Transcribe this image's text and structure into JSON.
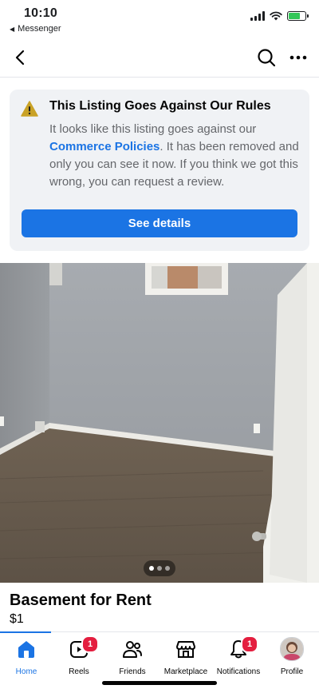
{
  "status_bar": {
    "time": "10:10",
    "back_app": "Messenger"
  },
  "nav": {
    "back_icon": "chevron-left-icon",
    "search_icon": "search-icon",
    "more_icon": "more-icon"
  },
  "notice": {
    "title": "This Listing Goes Against Our Rules",
    "body_before": "It looks like this listing goes against our ",
    "link": "Commerce Policies",
    "body_after": ". It has been removed and only you can see it now. If you think we got this wrong, you can request a review.",
    "button": "See details",
    "icon": "warning-icon"
  },
  "photo": {
    "page_count": 3,
    "active_index": 0
  },
  "listing": {
    "title": "Basement for Rent",
    "price": "$1"
  },
  "tabs": [
    {
      "label": "Home",
      "icon": "home-icon",
      "active": true
    },
    {
      "label": "Reels",
      "icon": "reels-icon",
      "badge": "1"
    },
    {
      "label": "Friends",
      "icon": "friends-icon"
    },
    {
      "label": "Marketplace",
      "icon": "marketplace-icon"
    },
    {
      "label": "Notifications",
      "icon": "bell-icon",
      "badge": "1"
    },
    {
      "label": "Profile",
      "icon": "avatar"
    }
  ],
  "colors": {
    "accent": "#1b74e4",
    "badge": "#e41e3f",
    "warning": "#c9a227",
    "card_bg": "#f0f2f5"
  }
}
